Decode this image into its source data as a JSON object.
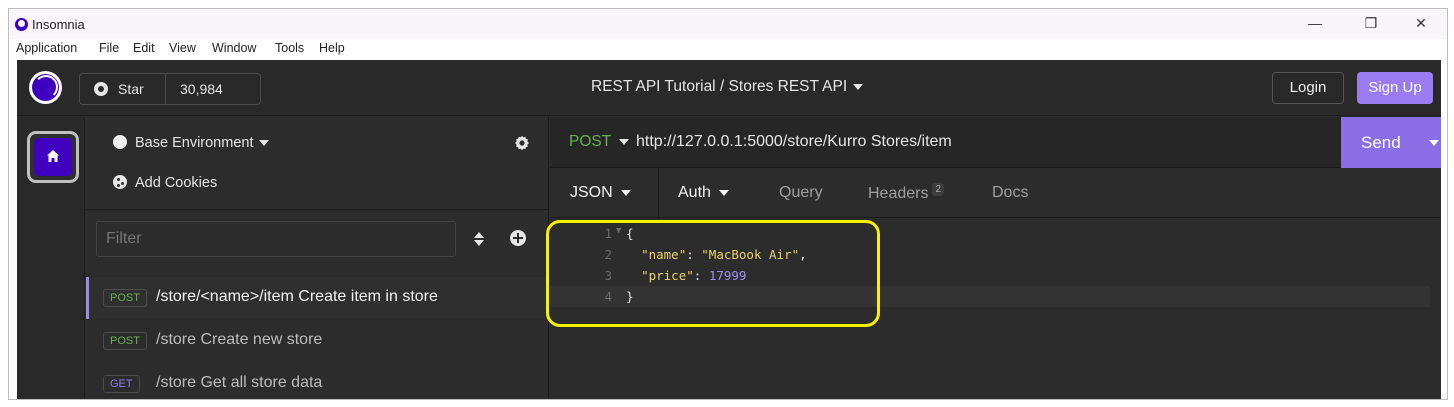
{
  "window": {
    "title": "Insomnia",
    "controls": {
      "minimize": "—",
      "maximize": "❐",
      "close": "✕"
    }
  },
  "menu": [
    "Application",
    "File",
    "Edit",
    "View",
    "Window",
    "Tools",
    "Help"
  ],
  "topbar": {
    "star_label": "Star",
    "star_count": "30,984",
    "breadcrumb": "REST API Tutorial / Stores REST API",
    "login_label": "Login",
    "signup_label": "Sign Up"
  },
  "sidebar": {
    "environment": "Base Environment",
    "cookies": "Add Cookies",
    "filter_placeholder": "Filter",
    "requests": [
      {
        "method": "POST",
        "label": "/store/<name>/item Create item in store",
        "active": true
      },
      {
        "method": "POST",
        "label": "/store Create new store",
        "active": false
      },
      {
        "method": "GET",
        "label": "/store Get all store data",
        "active": false
      }
    ]
  },
  "request": {
    "method": "POST",
    "url": "http://127.0.0.1:5000/store/Kurro Stores/item",
    "send_label": "Send",
    "tabs": {
      "body": "JSON",
      "auth": "Auth",
      "query": "Query",
      "headers": "Headers",
      "headers_count": "2",
      "docs": "Docs"
    }
  },
  "editor": {
    "line_numbers": [
      "1",
      "2",
      "3",
      "4"
    ],
    "open_brace": "{",
    "close_brace": "}",
    "name_key": "\"name\"",
    "name_value": "\"MacBook Air\"",
    "price_key": "\"price\"",
    "price_value": "17999"
  },
  "colors": {
    "accent": "#4000bf",
    "send": "#8a6ee6",
    "signup": "#9b7cf0",
    "post": "#6ab04c",
    "get": "#8e7ae6",
    "annotation": "#f6f200"
  }
}
